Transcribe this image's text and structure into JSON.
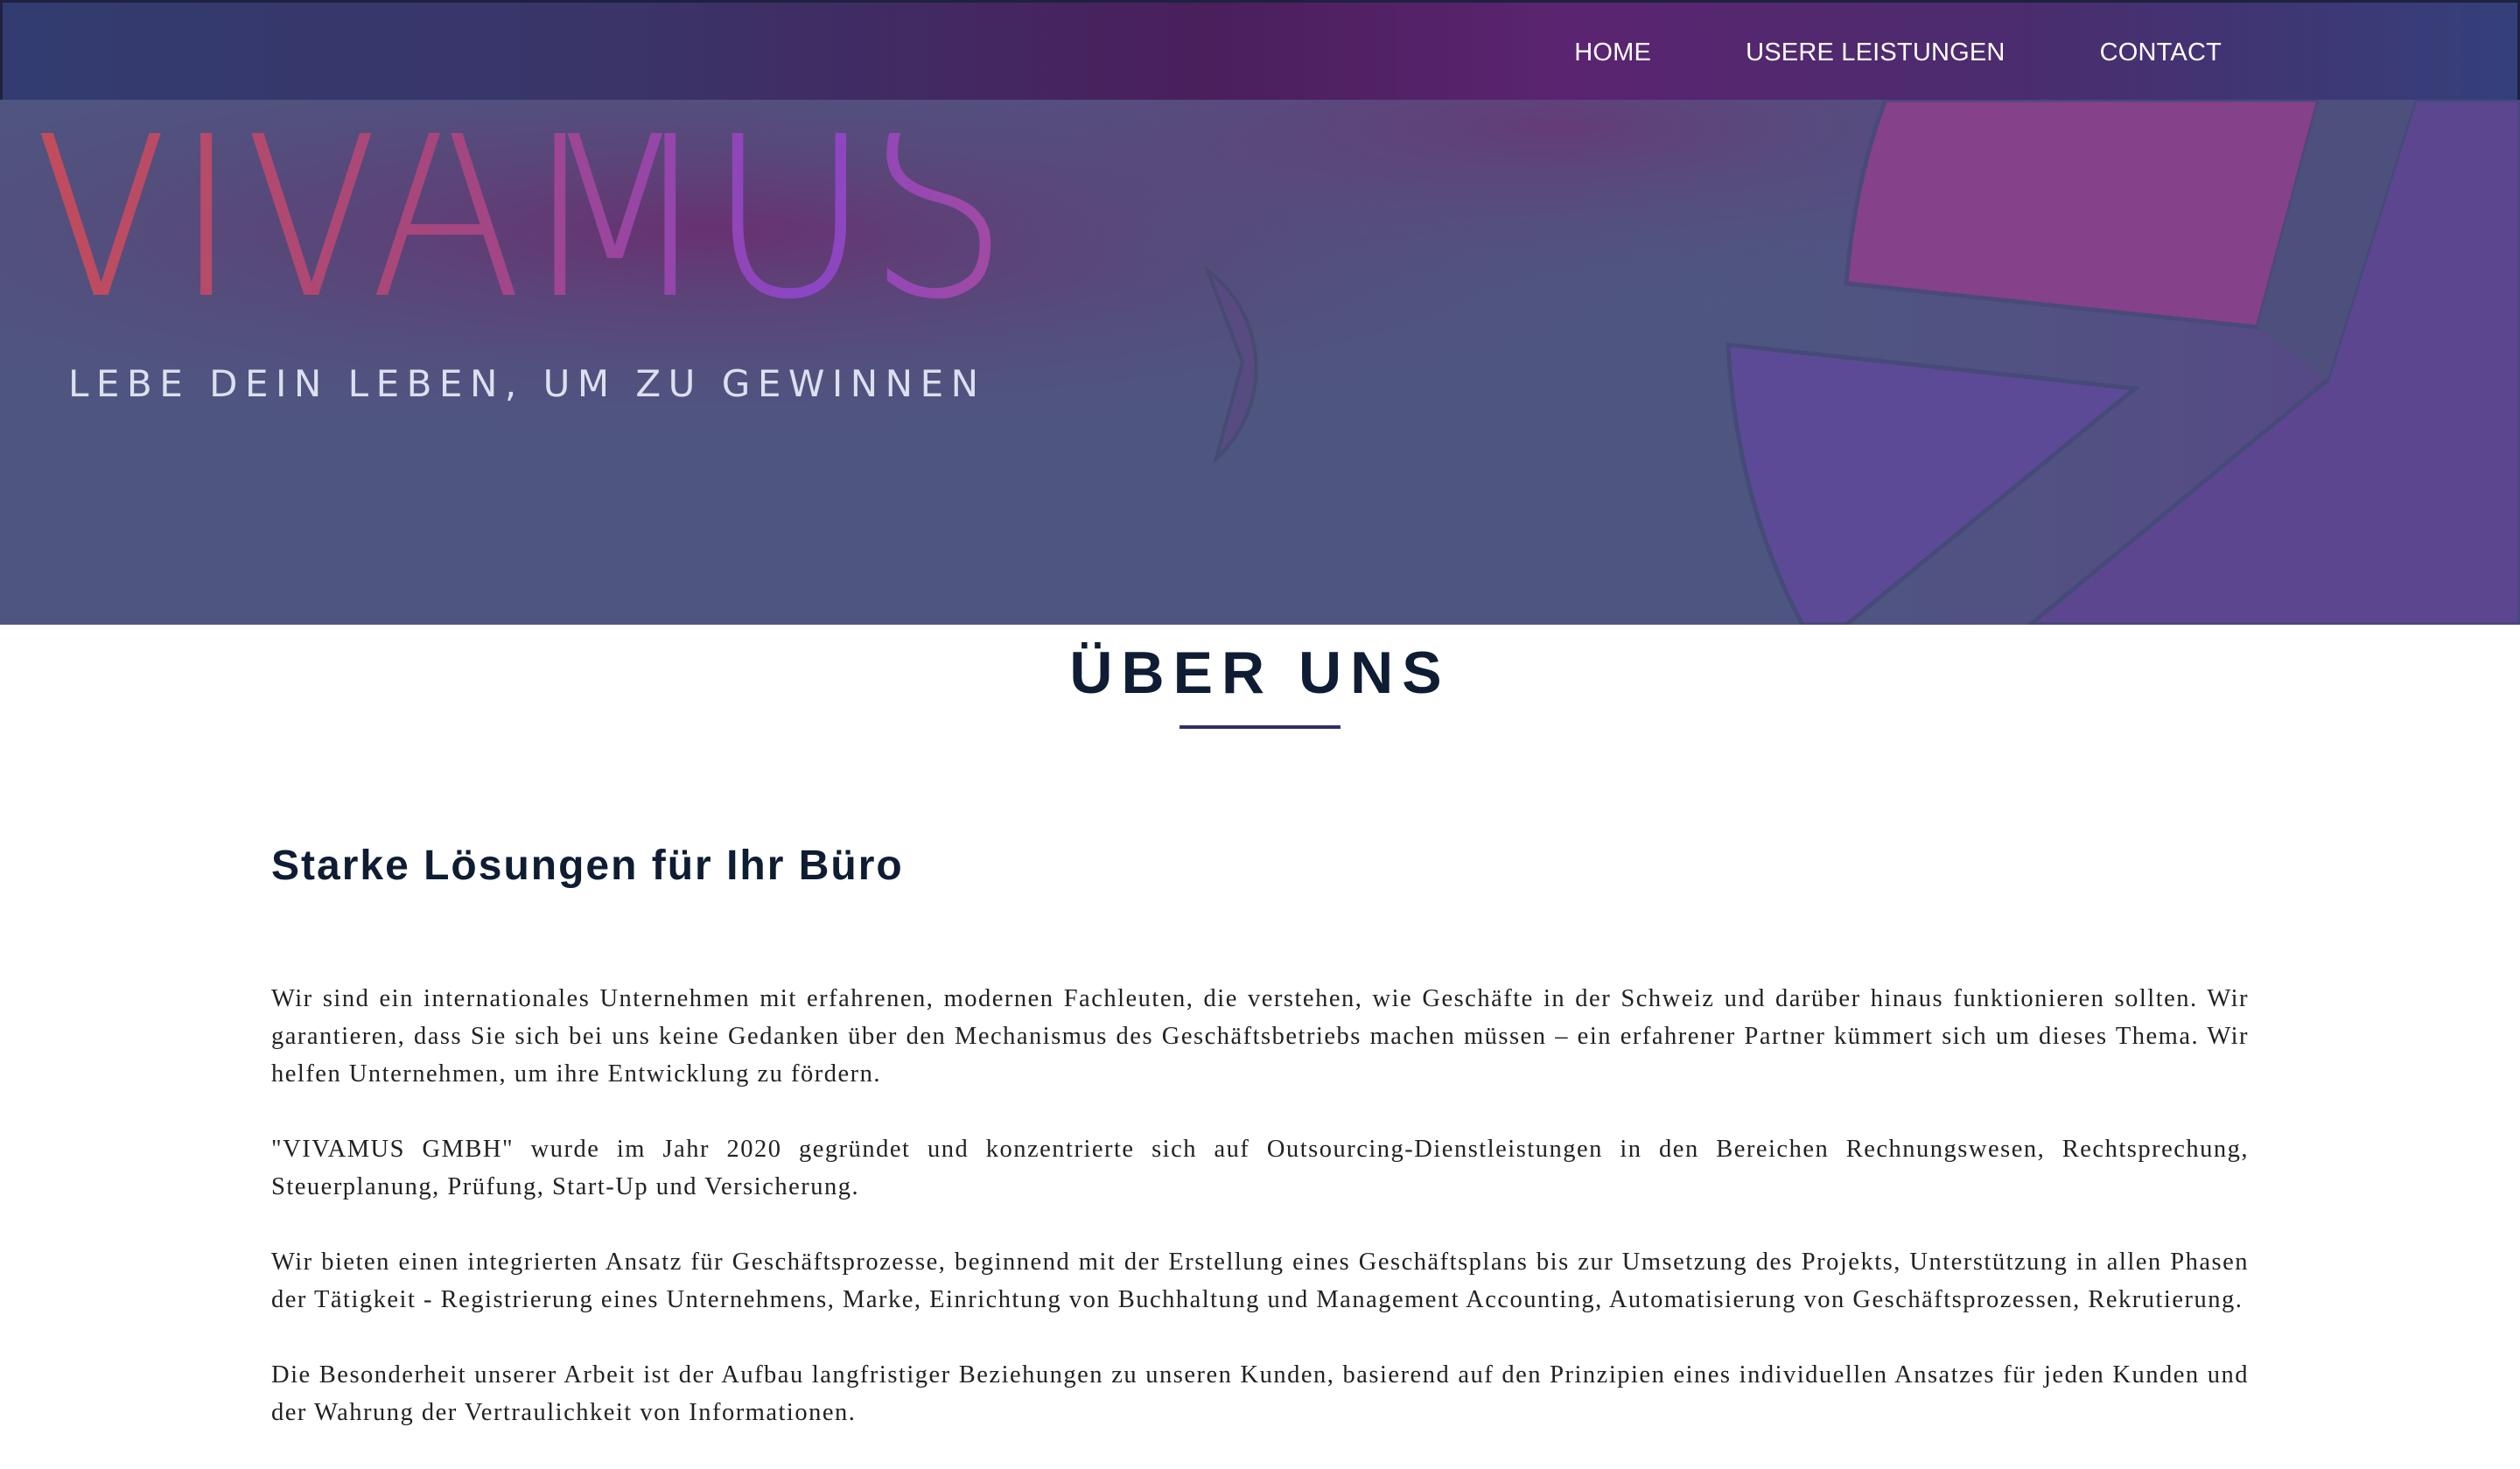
{
  "nav": {
    "items": [
      {
        "label": "HOME"
      },
      {
        "label": "USERE LEISTUNGEN"
      },
      {
        "label": "CONTACT"
      }
    ]
  },
  "hero": {
    "logo_text": "VIVAMUS",
    "tagline": "LEBE DEIN LEBEN, UM ZU GEWINNEN"
  },
  "about": {
    "title": "ÜBER UNS",
    "subheading": "Starke Lösungen für Ihr Büro",
    "paragraphs": [
      "Wir sind ein internationales Unternehmen mit erfahrenen, modernen Fachleuten, die verstehen, wie Geschäfte in der Schweiz und darüber hinaus funktionieren sollten. Wir garantieren, dass Sie sich bei uns keine Gedanken über den Mechanismus des Geschäftsbetriebs machen müssen – ein erfahrener Partner kümmert sich um dieses Thema. Wir helfen Unternehmen, um ihre Entwicklung zu fördern.",
      "\"VIVAMUS GMBH\" wurde im Jahr 2020 gegründet und konzentrierte sich auf Outsourcing-Dienstleistungen in den Bereichen Rechnungswesen, Rechtsprechung, Steuerplanung, Prüfung, Start-Up und Versicherung.",
      "Wir bieten einen integrierten Ansatz für Geschäftsprozesse, beginnend mit der Erstellung eines Geschäftsplans bis zur Umsetzung des Projekts, Unterstützung in allen Phasen der Tätigkeit - Registrierung eines Unternehmens, Marke, Einrichtung von Buchhaltung und Management Accounting, Automatisierung von Geschäftsprozessen, Rekrutierung.",
      "Die Besonderheit unserer Arbeit ist der Aufbau langfristiger Beziehungen zu unseren Kunden, basierend auf den Prinzipien eines individuellen Ansatzes für jeden Kunden und der Wahrung der Vertraulichkeit von Informationen."
    ]
  },
  "colors": {
    "nav_bg": "#3a3468",
    "hero_bg": "#4f5682",
    "logo_gradient_start": "#c24d5a",
    "logo_gradient_mid": "#9a3f9a",
    "logo_gradient_end": "#8a46c6",
    "heading": "#0e1d33",
    "underline": "#2c2f6b",
    "body_text": "#222222"
  }
}
